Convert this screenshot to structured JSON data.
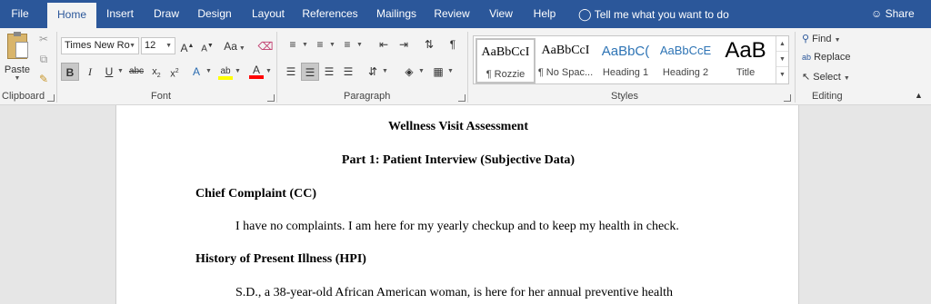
{
  "tabs": [
    "File",
    "Home",
    "Insert",
    "Draw",
    "Design",
    "Layout",
    "References",
    "Mailings",
    "Review",
    "View",
    "Help"
  ],
  "tell_me": "Tell me what you want to do",
  "share": "Share",
  "clipboard": {
    "paste": "Paste",
    "label": "Clipboard"
  },
  "font": {
    "name": "Times New Ro",
    "size": "12",
    "label": "Font",
    "aa_label": "Aa"
  },
  "paragraph": {
    "label": "Paragraph"
  },
  "styles": {
    "label": "Styles",
    "items": [
      {
        "sample": "AaBbCcI",
        "name": "¶ Rozzie"
      },
      {
        "sample": "AaBbCcI",
        "name": "¶ No Spac..."
      },
      {
        "sample": "AaBbC(",
        "name": "Heading 1"
      },
      {
        "sample": "AaBbCcE",
        "name": "Heading 2"
      },
      {
        "sample": "AaB",
        "name": "Title"
      }
    ]
  },
  "editing": {
    "find": "Find",
    "replace": "Replace",
    "select": "Select",
    "label": "Editing"
  },
  "document": {
    "title": "Wellness Visit Assessment",
    "part1": "Part 1: Patient Interview (Subjective Data)",
    "cc_heading": "Chief Complaint (CC)",
    "cc_text": "I have no complaints. I am here for my yearly checkup and to keep my health in check.",
    "hpi_heading": "History of Present Illness (HPI)",
    "hpi_text": "S.D., a 38-year-old African American woman, is here for her annual preventive health"
  },
  "colors": {
    "brand": "#2b579a",
    "highlight": "#ffff00",
    "font_color": "#ff0000"
  }
}
